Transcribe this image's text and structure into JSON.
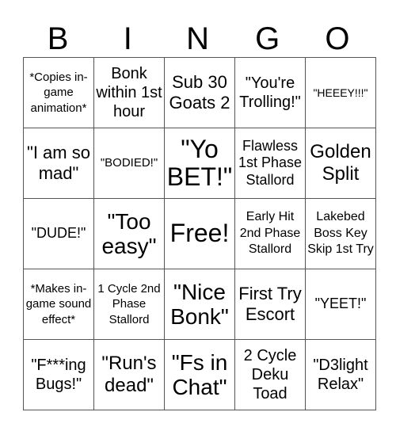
{
  "header": {
    "letters": [
      "B",
      "I",
      "N",
      "G",
      "O"
    ]
  },
  "rows": [
    [
      "*Copies in-game animation*",
      "Bonk within 1st hour",
      "Sub 30 Goats 2",
      "\"You're Trolling!\"",
      "\"HEEEY!!!\""
    ],
    [
      "\"I am so mad\"",
      "\"BODIED!\"",
      "\"Yo BET!\"",
      "Flawless 1st Phase Stallord",
      "Golden Split"
    ],
    [
      "\"DUDE!\"",
      "\"Too easy\"",
      "Free!",
      "Early Hit 2nd Phase Stallord",
      "Lakebed Boss Key Skip 1st Try"
    ],
    [
      "*Makes in-game sound effect*",
      "1 Cycle 2nd Phase Stallord",
      "\"Nice Bonk\"",
      "First Try Escort",
      "\"YEET!\""
    ],
    [
      "\"F***ing Bugs!\"",
      "\"Run's dead\"",
      "\"Fs in Chat\"",
      "2 Cycle Deku Toad",
      "\"D3light Relax\""
    ]
  ]
}
